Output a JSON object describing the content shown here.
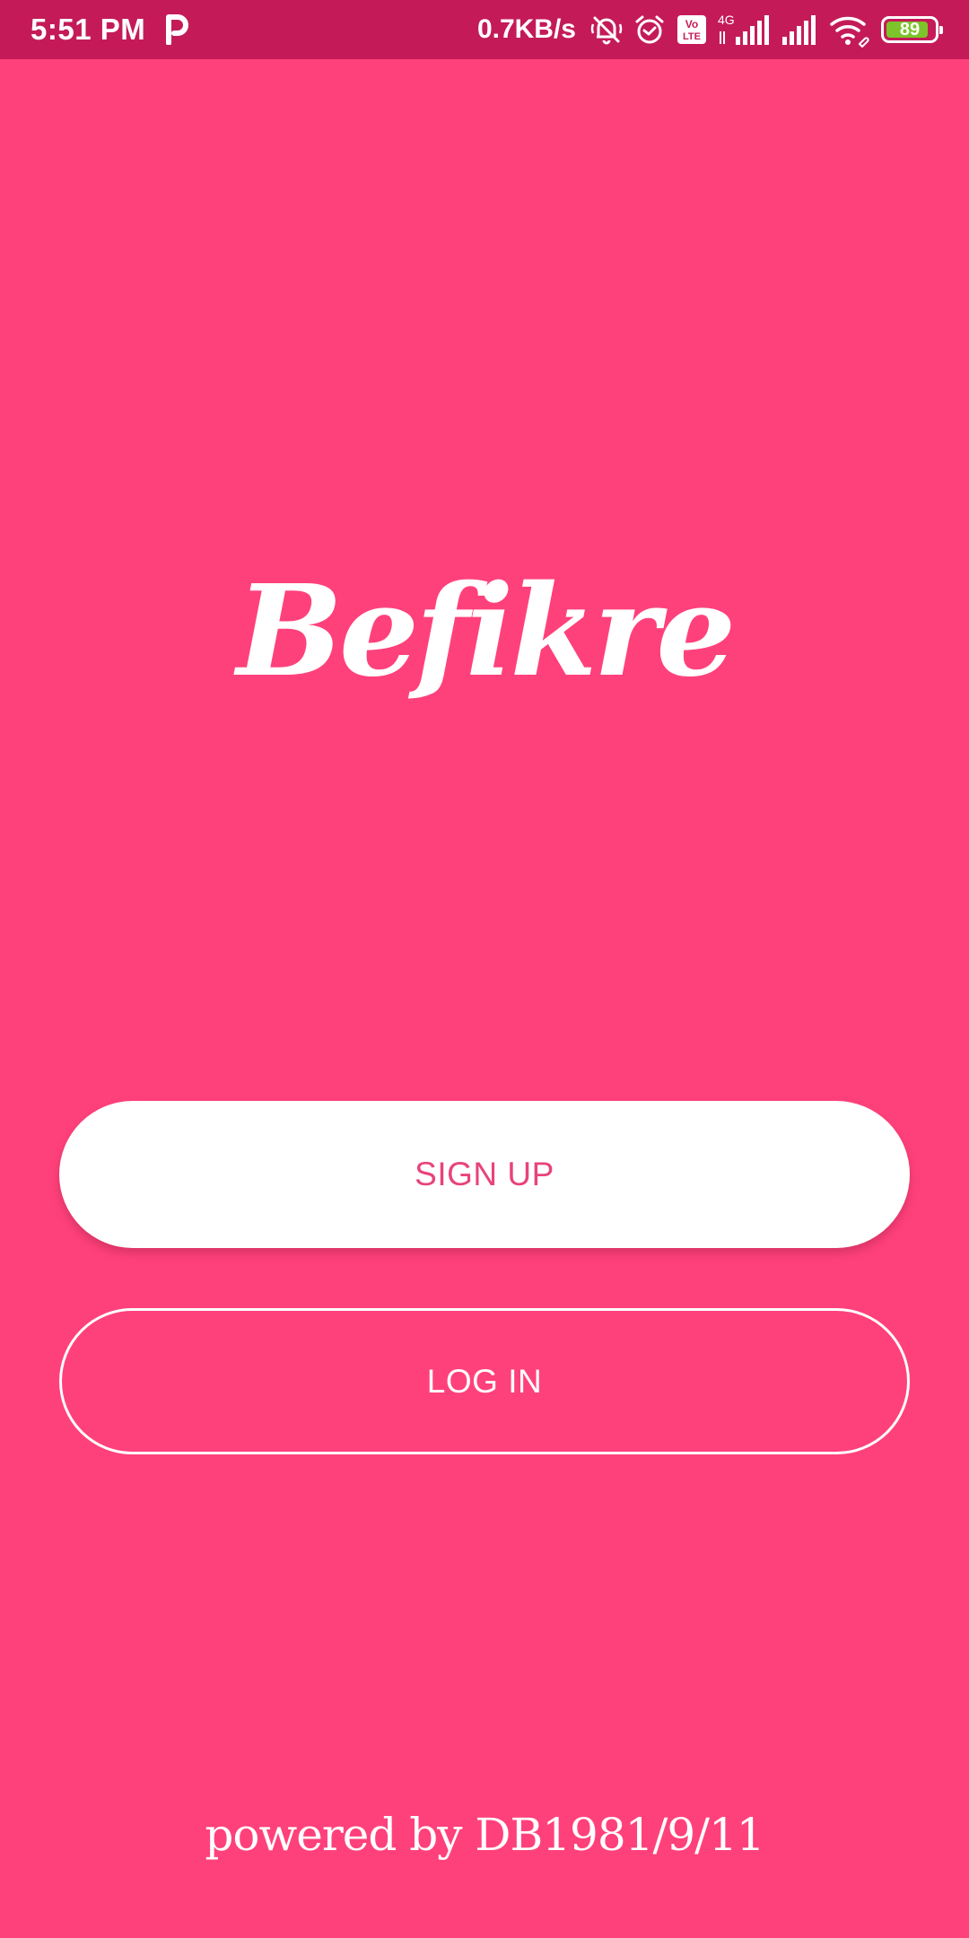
{
  "status_bar": {
    "time": "5:51 PM",
    "net_speed": "0.7KB/s",
    "network_type": "4G",
    "volte_label": "Vo LTE",
    "battery_level": "89",
    "battery_fraction": 0.89,
    "icons": [
      "parking-icon",
      "mute-icon",
      "alarm-icon",
      "volte-icon",
      "signal-icon",
      "wifi-icon",
      "battery-icon"
    ],
    "battery_color": "#7dc42a"
  },
  "logo": {
    "text": "Befikre"
  },
  "buttons": {
    "signup_label": "SIGN UP",
    "login_label": "LOG IN"
  },
  "footer": {
    "text": "powered by DB1981/9/11"
  },
  "colors": {
    "background": "#ff417b",
    "status_bar": "#c41b58",
    "signup_text": "#e8437a"
  }
}
